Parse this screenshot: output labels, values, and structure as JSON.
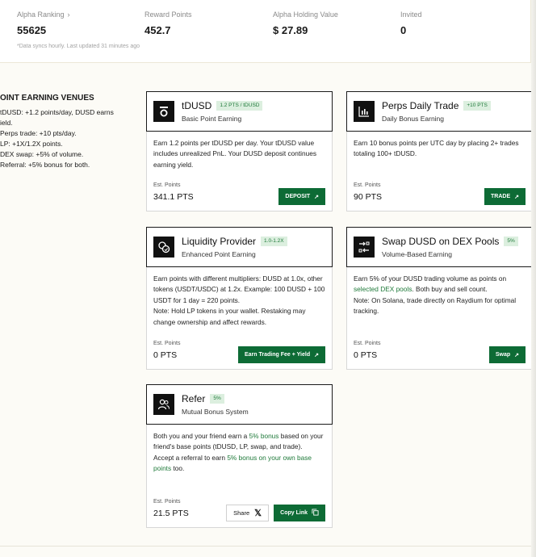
{
  "stats": [
    {
      "label": "Alpha Ranking",
      "value": "55625",
      "has_chevron": true
    },
    {
      "label": "Reward Points",
      "value": "452.7"
    },
    {
      "label": "Alpha Holding Value",
      "value": "$ 27.89"
    },
    {
      "label": "Invited",
      "value": "0"
    }
  ],
  "sync_note": "*Data syncs hourly. Last updated 31 minutes ago",
  "venues": {
    "title": "OINT EARNING VENUES",
    "items": [
      "tDUSD: +1.2 points/day, DUSD earns",
      "ield.",
      "Perps trade: +10 pts/day.",
      "LP: +1X/1.2X points.",
      "DEX swap: +5% of volume.",
      "Referral: +5% bonus for both."
    ]
  },
  "cards": {
    "tdusd": {
      "icon": "tdusd-icon",
      "title": "tDUSD",
      "tag": "1.2 PTS / tDUSD",
      "subtitle": "Basic Point Earning",
      "desc": "Earn 1.2 points per tDUSD per day. Your tDUSD value includes unrealized PnL. Your DUSD deposit continues earning yield.",
      "est_label": "Est. Points",
      "est_value": "341.1 PTS",
      "button": "DEPOSIT"
    },
    "perps": {
      "icon": "chart-icon",
      "title": "Perps Daily Trade",
      "tag": "+10 PTS",
      "subtitle": "Daily Bonus Earning",
      "desc": "Earn 10 bonus points per UTC day by placing 2+ trades totaling 100+ tDUSD.",
      "est_label": "Est. Points",
      "est_value": "90 PTS",
      "button": "TRADE"
    },
    "lp": {
      "icon": "coins-icon",
      "title": "Liquidity Provider",
      "tag": "1.0-1.2X",
      "subtitle": "Enhanced Point Earning",
      "desc1": "Earn points with different multipliers: DUSD at 1.0x, other tokens (USDT/USDC) at 1.2x. Example: 100 DUSD + 100 USDT for 1 day = 220 points.",
      "desc2": "Note: Hold LP tokens in your wallet. Restaking may change ownership and affect rewards.",
      "est_label": "Est. Points",
      "est_value": "0 PTS",
      "button": "Earn Trading Fee + Yield"
    },
    "swap": {
      "icon": "swap-icon",
      "title": "Swap DUSD on DEX Pools",
      "tag": "5%",
      "subtitle": "Volume-Based Earning",
      "desc_a": "Earn 5% of your DUSD trading volume as points on ",
      "desc_link": "selected DEX pools",
      "desc_b": ". Both buy and sell count.",
      "desc2": "Note: On Solana, trade directly on Raydium for optimal tracking.",
      "est_label": "Est. Points",
      "est_value": "0 PTS",
      "button": "Swap"
    },
    "refer": {
      "icon": "users-icon",
      "title": "Refer",
      "tag": "5%",
      "subtitle": "Mutual Bonus System",
      "desc_a": "Both you and your friend earn a ",
      "desc_g1": "5% bonus",
      "desc_b": " based on your friend's base points (tDUSD, LP, swap, and trade).",
      "desc_c": "Accept a referral to earn ",
      "desc_g2": "5% bonus on your own base points",
      "desc_d": " too.",
      "est_label": "Est. Points",
      "est_value": "21.5 PTS",
      "share_button": "Share",
      "copy_button": "Copy Link"
    }
  },
  "colors": {
    "accent": "#0d6b35",
    "tag_bg": "#dcefdf",
    "tag_text": "#1f7a3a"
  }
}
